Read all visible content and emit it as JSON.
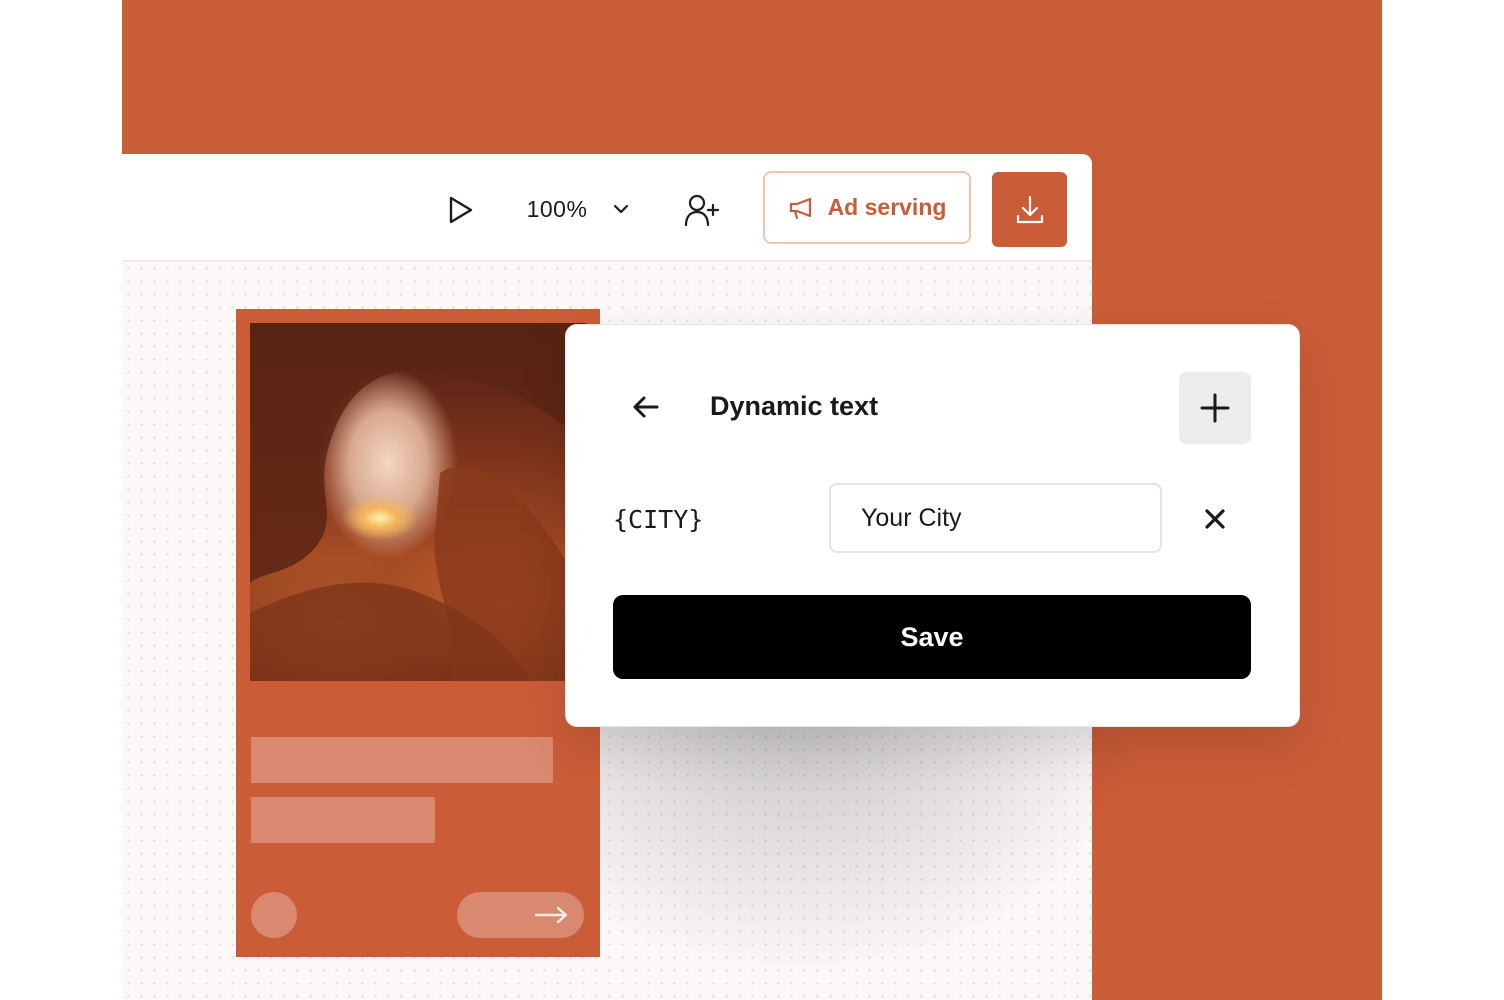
{
  "colors": {
    "brand": "#cb5c38",
    "panel_background": "#ffffff",
    "save_button": "#000000",
    "ad_button_border": "#f0c4b4"
  },
  "toolbar": {
    "play_icon": "play-icon",
    "zoom_value": "100%",
    "zoom_icon": "chevron-down-icon",
    "share_icon": "user-plus-icon",
    "ad_serving_icon": "megaphone-icon",
    "ad_serving_label": "Ad serving",
    "download_icon": "download-icon"
  },
  "dynamic_text_panel": {
    "back_icon": "arrow-left-icon",
    "title": "Dynamic text",
    "add_icon": "plus-icon",
    "variables": [
      {
        "key": "{CITY}",
        "value": "Your City",
        "remove_icon": "close-icon"
      }
    ],
    "save_label": "Save"
  },
  "ad_preview": {
    "image": "canyon-arch-sunset-photo",
    "cta_icon": "arrow-right-icon"
  }
}
